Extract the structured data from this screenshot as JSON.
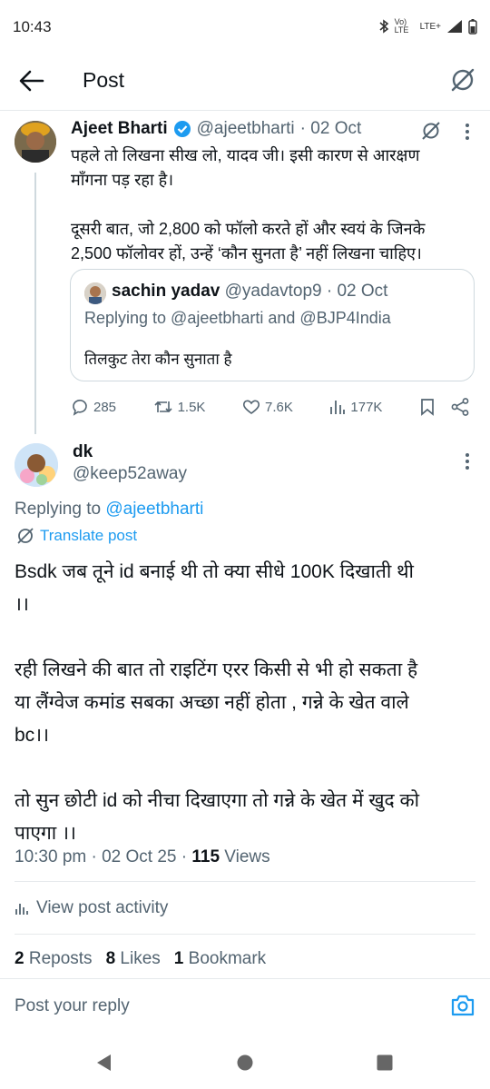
{
  "status_bar": {
    "time": "10:43",
    "network": "LTE+",
    "volte": "Vo) LTE"
  },
  "header": {
    "title": "Post"
  },
  "parent_post": {
    "name": "Ajeet Bharti",
    "handle": "@ajeetbharti",
    "date": "· 02 Oct",
    "text_line1": "पहले तो लिखना सीख लो, यादव जी। इसी कारण से आरक्षण",
    "text_line2": "माँगना पड़ रहा है।",
    "text_line3": "दूसरी बात, जो 2,800 को फॉलो करते हों और स्वयं के जिनके",
    "text_line4": "2,500 फॉलोवर हों, उन्हें ‘कौन सुनता है’ नहीं लिखना चाहिए।",
    "quoted": {
      "name": "sachin yadav",
      "handle": "@yadavtop9",
      "date": "· 02 Oct",
      "replying": "Replying to @ajeetbharti and @BJP4India",
      "text": "तिलकुट तेरा कौन सुनाता है"
    },
    "stats": {
      "replies": "285",
      "reposts": "1.5K",
      "likes": "7.6K",
      "views": "177K"
    }
  },
  "main_post": {
    "name": "dk",
    "handle": "@keep52away",
    "replying_prefix": "Replying to ",
    "replying_handle": "@ajeetbharti",
    "translate": "Translate post",
    "text_line1": "Bsdk जब तूने id बनाई थी तो क्या सीधे 100K दिखाती थी",
    "text_line2": "।।",
    "text_line3": "रही लिखने की बात तो राइटिंग एरर किसी से भी हो सकता है",
    "text_line4": "या लैंग्वेज कमांड सबका अच्छा नहीं होता , गन्ने के खेत वाले",
    "text_line5": "bc।।",
    "text_line6": "तो सुन छोटी id को नीचा दिखाएगा तो गन्ने के खेत में खुद को",
    "text_line7": "पाएगा ।।",
    "timestamp": "10:30 pm · 02 Oct 25 · ",
    "views_count": "115",
    "views_label": " Views",
    "activity": "View post activity",
    "reposts_count": "2",
    "reposts_label": "Reposts",
    "likes_count": "8",
    "likes_label": "Likes",
    "bookmarks_count": "1",
    "bookmarks_label": "Bookmark"
  },
  "reply_box": {
    "placeholder": "Post your reply"
  },
  "colors": {
    "accent": "#1d9bf0",
    "muted": "#536471",
    "border": "#cfd9de"
  }
}
